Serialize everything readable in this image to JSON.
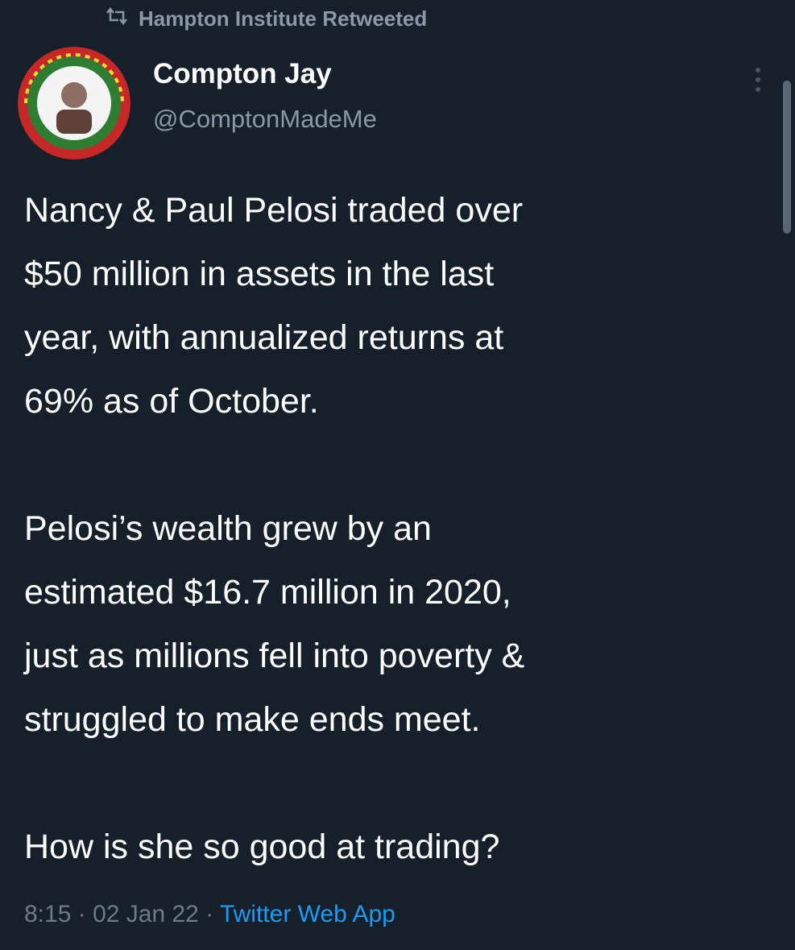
{
  "retweet": {
    "icon": "retweet-icon",
    "label": "Hampton Institute Retweeted"
  },
  "author": {
    "display_name": "Compton Jay",
    "handle": "@ComptonMadeMe",
    "avatar": "avatar-seal-image"
  },
  "tweet": {
    "paragraphs": [
      "Nancy & Paul Pelosi traded over $50 million in assets in the last year, with annualized returns at 69% as of October.",
      "Pelosi’s wealth grew by an estimated $16.7 million in 2020, just as millions fell into poverty & struggled to make ends meet.",
      "How is she so good at trading?"
    ],
    "lines": [
      [
        "Nancy & Paul Pelosi traded over",
        "$50 million in assets in the last",
        "year, with annualized returns at",
        "69% as of October."
      ],
      [
        "Pelosi’s wealth grew by an",
        "estimated $16.7 million in 2020,",
        "just as millions fell into poverty &",
        "struggled to make ends meet."
      ],
      [
        "How is she so good at trading?"
      ]
    ]
  },
  "meta": {
    "time": "8:15",
    "separator": " · ",
    "date": "02 Jan 22",
    "source": "Twitter Web App"
  },
  "colors": {
    "background": "#15202b",
    "text": "#ffffff",
    "secondary": "#8b98a5",
    "link": "#1d9bf0"
  }
}
